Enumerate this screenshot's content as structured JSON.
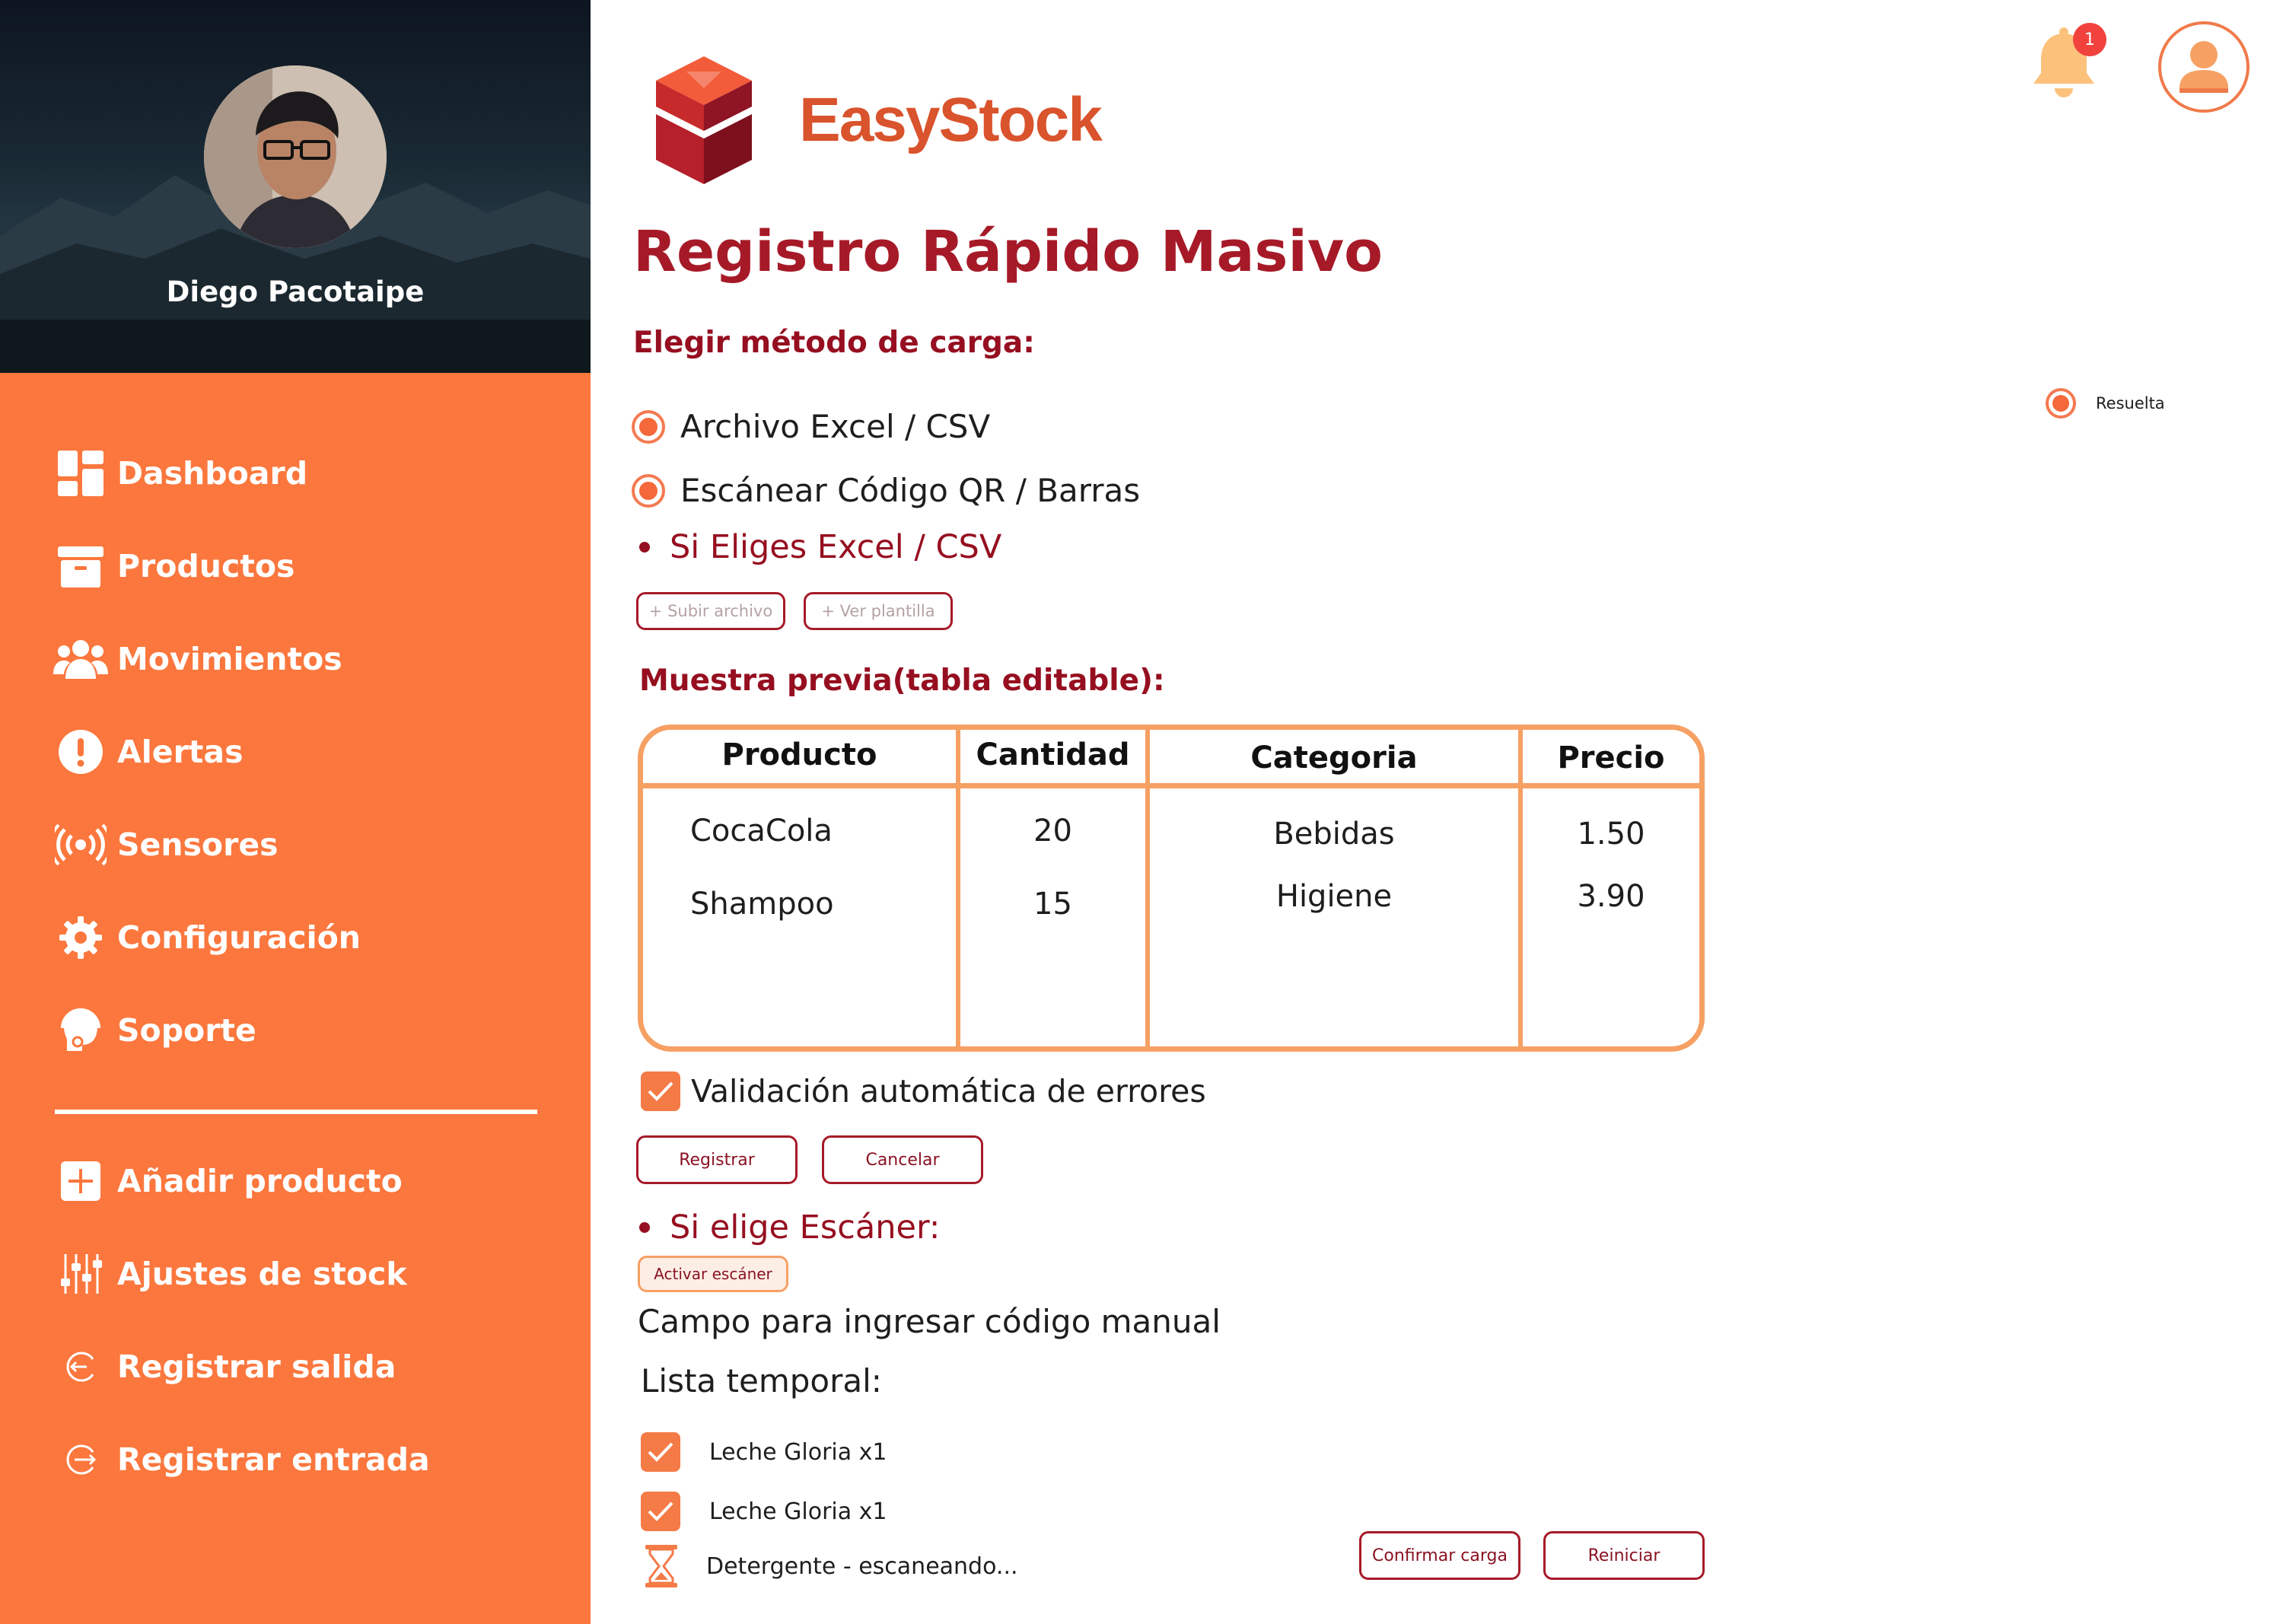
{
  "sidebar": {
    "user_name": "Diego Pacotaipe",
    "items": [
      {
        "label": "Dashboard",
        "icon": "dashboard-icon"
      },
      {
        "label": "Productos",
        "icon": "archive-box-icon"
      },
      {
        "label": "Movimientos",
        "icon": "users-icon"
      },
      {
        "label": "Alertas",
        "icon": "alert-icon"
      },
      {
        "label": "Sensores",
        "icon": "sensor-icon"
      },
      {
        "label": "Configuración",
        "icon": "gear-icon"
      },
      {
        "label": "Soporte",
        "icon": "support-icon"
      }
    ],
    "actions": [
      {
        "label": "Añadir producto",
        "icon": "plus-square-icon"
      },
      {
        "label": "Ajustes de stock",
        "icon": "sliders-icon"
      },
      {
        "label": "Registrar salida",
        "icon": "exit-icon"
      },
      {
        "label": "Registrar entrada",
        "icon": "enter-icon"
      }
    ]
  },
  "header": {
    "brand": "EasyStock",
    "notification_count": "1"
  },
  "main": {
    "title": "Registro Rápido Masivo",
    "method_label": "Elegir método de carga:",
    "methods": [
      {
        "label": "Archivo Excel / CSV",
        "selected": true
      },
      {
        "label": "Escánear Código QR / Barras",
        "selected": true
      }
    ],
    "status_label": "Resuelta",
    "excel": {
      "heading": "Si Eliges Excel / CSV",
      "upload_button": "+ Subir archivo",
      "template_button": "+ Ver plantilla",
      "preview_label": "Muestra previa(tabla editable):",
      "table": {
        "headers": [
          "Producto",
          "Cantidad",
          "Categoria",
          "Precio"
        ],
        "rows": [
          [
            "CocaCola",
            "20",
            "Bebidas",
            "1.50"
          ],
          [
            "Shampoo",
            "15",
            "Higiene",
            "3.90"
          ]
        ]
      },
      "validation_label": "Validación automática de errores",
      "validation_checked": true,
      "register_button": "Registrar",
      "cancel_button": "Cancelar"
    },
    "scanner": {
      "heading": "Si elige Escáner:",
      "activate_button": "Activar escáner",
      "manual_field_label": "Campo para ingresar código manual",
      "temp_list_label": "Lista temporal:",
      "items": [
        {
          "label": "Leche Gloria x1",
          "status": "done"
        },
        {
          "label": "Leche Gloria x1",
          "status": "done"
        },
        {
          "label": "Detergente - escaneando...",
          "status": "pending"
        }
      ],
      "confirm_button": "Confirmar carga",
      "reset_button": "Reiniciar"
    }
  },
  "colors": {
    "sidebar": "#fb773d",
    "accent": "#a61a28",
    "table_border": "#f6a064",
    "checkbox": "#f47a46"
  }
}
